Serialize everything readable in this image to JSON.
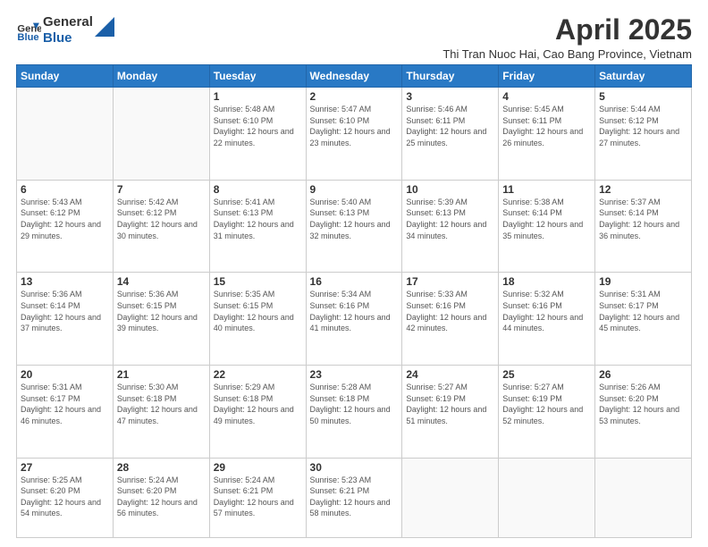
{
  "header": {
    "logo_text_general": "General",
    "logo_text_blue": "Blue",
    "month_title": "April 2025",
    "location": "Thi Tran Nuoc Hai, Cao Bang Province, Vietnam"
  },
  "days_of_week": [
    "Sunday",
    "Monday",
    "Tuesday",
    "Wednesday",
    "Thursday",
    "Friday",
    "Saturday"
  ],
  "weeks": [
    [
      {
        "day": "",
        "sunrise": "",
        "sunset": "",
        "daylight": ""
      },
      {
        "day": "",
        "sunrise": "",
        "sunset": "",
        "daylight": ""
      },
      {
        "day": "1",
        "sunrise": "Sunrise: 5:48 AM",
        "sunset": "Sunset: 6:10 PM",
        "daylight": "Daylight: 12 hours and 22 minutes."
      },
      {
        "day": "2",
        "sunrise": "Sunrise: 5:47 AM",
        "sunset": "Sunset: 6:10 PM",
        "daylight": "Daylight: 12 hours and 23 minutes."
      },
      {
        "day": "3",
        "sunrise": "Sunrise: 5:46 AM",
        "sunset": "Sunset: 6:11 PM",
        "daylight": "Daylight: 12 hours and 25 minutes."
      },
      {
        "day": "4",
        "sunrise": "Sunrise: 5:45 AM",
        "sunset": "Sunset: 6:11 PM",
        "daylight": "Daylight: 12 hours and 26 minutes."
      },
      {
        "day": "5",
        "sunrise": "Sunrise: 5:44 AM",
        "sunset": "Sunset: 6:12 PM",
        "daylight": "Daylight: 12 hours and 27 minutes."
      }
    ],
    [
      {
        "day": "6",
        "sunrise": "Sunrise: 5:43 AM",
        "sunset": "Sunset: 6:12 PM",
        "daylight": "Daylight: 12 hours and 29 minutes."
      },
      {
        "day": "7",
        "sunrise": "Sunrise: 5:42 AM",
        "sunset": "Sunset: 6:12 PM",
        "daylight": "Daylight: 12 hours and 30 minutes."
      },
      {
        "day": "8",
        "sunrise": "Sunrise: 5:41 AM",
        "sunset": "Sunset: 6:13 PM",
        "daylight": "Daylight: 12 hours and 31 minutes."
      },
      {
        "day": "9",
        "sunrise": "Sunrise: 5:40 AM",
        "sunset": "Sunset: 6:13 PM",
        "daylight": "Daylight: 12 hours and 32 minutes."
      },
      {
        "day": "10",
        "sunrise": "Sunrise: 5:39 AM",
        "sunset": "Sunset: 6:13 PM",
        "daylight": "Daylight: 12 hours and 34 minutes."
      },
      {
        "day": "11",
        "sunrise": "Sunrise: 5:38 AM",
        "sunset": "Sunset: 6:14 PM",
        "daylight": "Daylight: 12 hours and 35 minutes."
      },
      {
        "day": "12",
        "sunrise": "Sunrise: 5:37 AM",
        "sunset": "Sunset: 6:14 PM",
        "daylight": "Daylight: 12 hours and 36 minutes."
      }
    ],
    [
      {
        "day": "13",
        "sunrise": "Sunrise: 5:36 AM",
        "sunset": "Sunset: 6:14 PM",
        "daylight": "Daylight: 12 hours and 37 minutes."
      },
      {
        "day": "14",
        "sunrise": "Sunrise: 5:36 AM",
        "sunset": "Sunset: 6:15 PM",
        "daylight": "Daylight: 12 hours and 39 minutes."
      },
      {
        "day": "15",
        "sunrise": "Sunrise: 5:35 AM",
        "sunset": "Sunset: 6:15 PM",
        "daylight": "Daylight: 12 hours and 40 minutes."
      },
      {
        "day": "16",
        "sunrise": "Sunrise: 5:34 AM",
        "sunset": "Sunset: 6:16 PM",
        "daylight": "Daylight: 12 hours and 41 minutes."
      },
      {
        "day": "17",
        "sunrise": "Sunrise: 5:33 AM",
        "sunset": "Sunset: 6:16 PM",
        "daylight": "Daylight: 12 hours and 42 minutes."
      },
      {
        "day": "18",
        "sunrise": "Sunrise: 5:32 AM",
        "sunset": "Sunset: 6:16 PM",
        "daylight": "Daylight: 12 hours and 44 minutes."
      },
      {
        "day": "19",
        "sunrise": "Sunrise: 5:31 AM",
        "sunset": "Sunset: 6:17 PM",
        "daylight": "Daylight: 12 hours and 45 minutes."
      }
    ],
    [
      {
        "day": "20",
        "sunrise": "Sunrise: 5:31 AM",
        "sunset": "Sunset: 6:17 PM",
        "daylight": "Daylight: 12 hours and 46 minutes."
      },
      {
        "day": "21",
        "sunrise": "Sunrise: 5:30 AM",
        "sunset": "Sunset: 6:18 PM",
        "daylight": "Daylight: 12 hours and 47 minutes."
      },
      {
        "day": "22",
        "sunrise": "Sunrise: 5:29 AM",
        "sunset": "Sunset: 6:18 PM",
        "daylight": "Daylight: 12 hours and 49 minutes."
      },
      {
        "day": "23",
        "sunrise": "Sunrise: 5:28 AM",
        "sunset": "Sunset: 6:18 PM",
        "daylight": "Daylight: 12 hours and 50 minutes."
      },
      {
        "day": "24",
        "sunrise": "Sunrise: 5:27 AM",
        "sunset": "Sunset: 6:19 PM",
        "daylight": "Daylight: 12 hours and 51 minutes."
      },
      {
        "day": "25",
        "sunrise": "Sunrise: 5:27 AM",
        "sunset": "Sunset: 6:19 PM",
        "daylight": "Daylight: 12 hours and 52 minutes."
      },
      {
        "day": "26",
        "sunrise": "Sunrise: 5:26 AM",
        "sunset": "Sunset: 6:20 PM",
        "daylight": "Daylight: 12 hours and 53 minutes."
      }
    ],
    [
      {
        "day": "27",
        "sunrise": "Sunrise: 5:25 AM",
        "sunset": "Sunset: 6:20 PM",
        "daylight": "Daylight: 12 hours and 54 minutes."
      },
      {
        "day": "28",
        "sunrise": "Sunrise: 5:24 AM",
        "sunset": "Sunset: 6:20 PM",
        "daylight": "Daylight: 12 hours and 56 minutes."
      },
      {
        "day": "29",
        "sunrise": "Sunrise: 5:24 AM",
        "sunset": "Sunset: 6:21 PM",
        "daylight": "Daylight: 12 hours and 57 minutes."
      },
      {
        "day": "30",
        "sunrise": "Sunrise: 5:23 AM",
        "sunset": "Sunset: 6:21 PM",
        "daylight": "Daylight: 12 hours and 58 minutes."
      },
      {
        "day": "",
        "sunrise": "",
        "sunset": "",
        "daylight": ""
      },
      {
        "day": "",
        "sunrise": "",
        "sunset": "",
        "daylight": ""
      },
      {
        "day": "",
        "sunrise": "",
        "sunset": "",
        "daylight": ""
      }
    ]
  ]
}
